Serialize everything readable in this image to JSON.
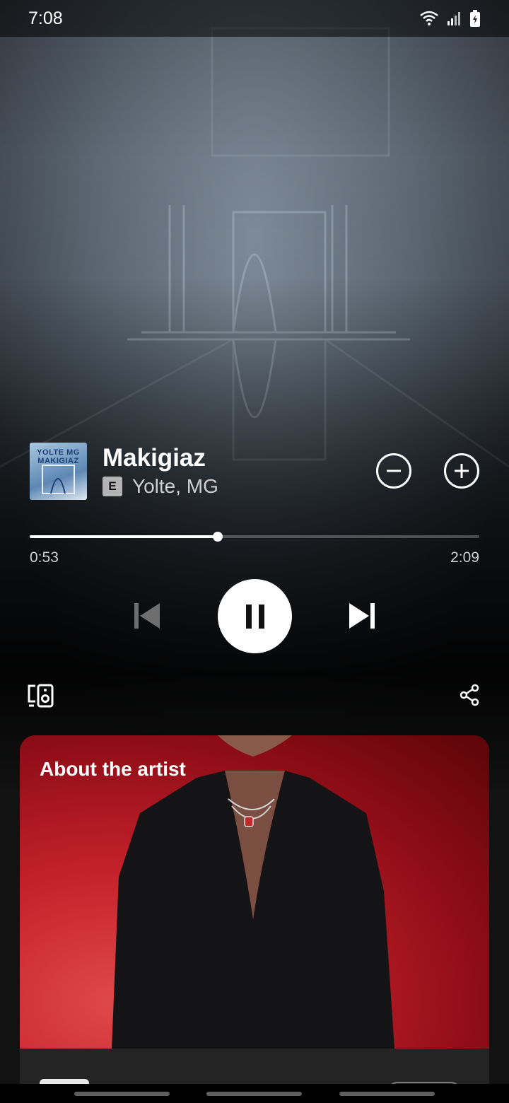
{
  "status_bar": {
    "time": "7:08",
    "icons": [
      "wifi-icon",
      "signal-icon",
      "battery-charging-icon"
    ]
  },
  "now_playing": {
    "cover_text": "YOLTE MG MAKIGIAZ",
    "title": "Makigiaz",
    "explicit_label": "E",
    "artists": "Yolte, MG",
    "progress_fraction": 0.418,
    "elapsed": "0:53",
    "duration": "2:09"
  },
  "controls": {
    "icons": [
      "previous-icon",
      "pause-icon",
      "next-icon"
    ],
    "previous_enabled": false,
    "is_playing": true
  },
  "secondary_actions": [
    "connect-device-icon",
    "share-icon",
    "remove-icon",
    "add-icon"
  ],
  "artist_card": {
    "title": "About the artist"
  },
  "colors": {
    "background": "#121212",
    "card_red": "#c3212a",
    "text_secondary": "#cfcfcf"
  }
}
